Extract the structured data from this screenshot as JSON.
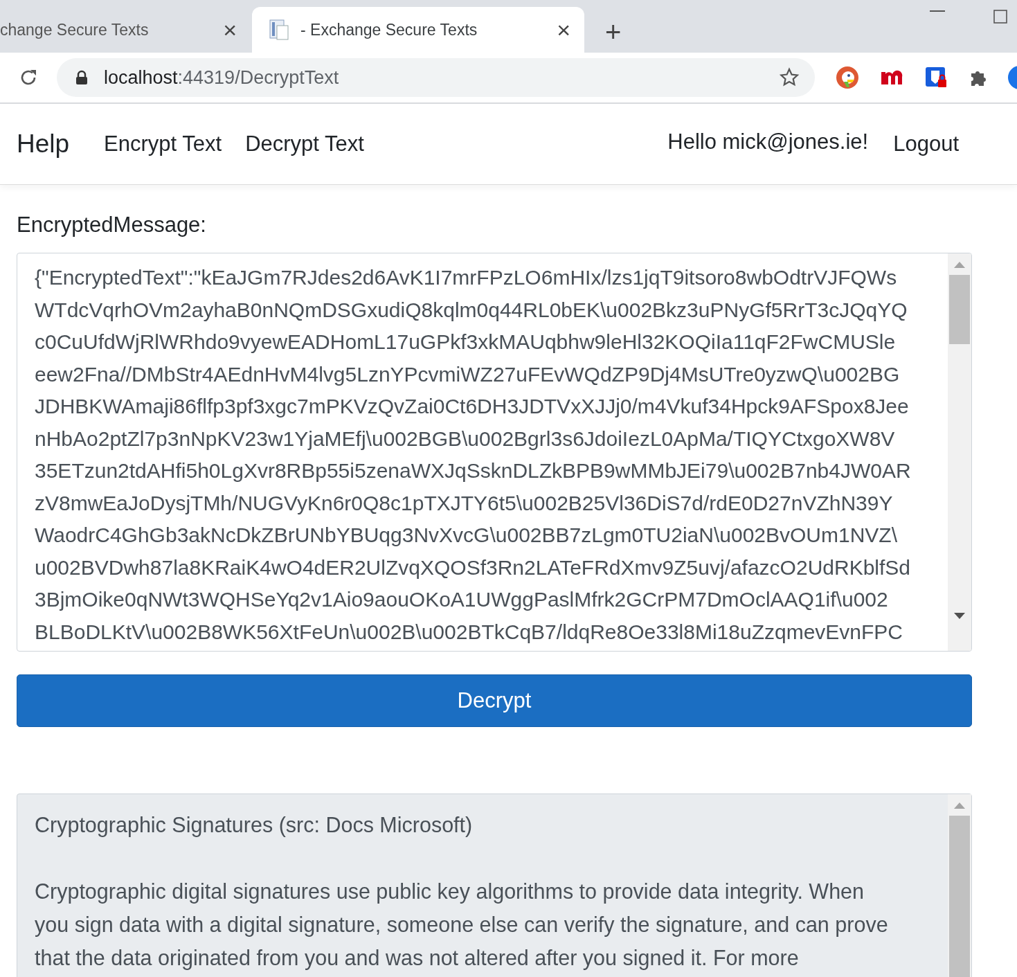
{
  "browser": {
    "tabs": [
      {
        "title": "change Secure Texts",
        "selected": false,
        "close": "×"
      },
      {
        "title": "- Exchange Secure Texts",
        "selected": true,
        "close": "×"
      }
    ],
    "new_tab": "+",
    "url_host": "localhost",
    "url_rest": ":44319/DecryptText"
  },
  "navbar": {
    "brand": "Help",
    "links": [
      "Encrypt Text",
      "Decrypt Text"
    ],
    "greeting": "Hello mick@jones.ie!",
    "logout": "Logout"
  },
  "form": {
    "label": "EncryptedMessage:",
    "value_lines": [
      "{\"EncryptedText\":\"kEaJGm7RJdes2d6AvK1I7mrFPzLO6mHIx/lzs1jqT9itsoro8wbOdtrVJFQWs",
      "WTdcVqrhOVm2ayhaB0nNQmDSGxudiQ8kqlm0q44RL0bEK\\u002Bkz3uPNyGf5RrT3cJQqYQ",
      "c0CuUfdWjRlWRhdo9vyewEADHomL17uGPkf3xkMAUqbhw9leHl32KOQiIa11qF2FwCMUSle",
      "eew2Fna//DMbStr4AEdnHvM4lvg5LznYPcvmiWZ27uFEvWQdZP9Dj4MsUTre0yzwQ\\u002BG",
      "JDHBKWAmaji86flfp3pf3xgc7mPKVzQvZai0Ct6DH3JDTVxXJJj0/m4Vkuf34Hpck9AFSpox8Jee",
      "nHbAo2ptZl7p3nNpKV23w1YjaMEfj\\u002BGB\\u002Bgrl3s6JdoiIezL0ApMa/TIQYCtxgoXW8V",
      "35ETzun2tdAHfi5h0LgXvr8RBp55i5zenaWXJqSsknDLZkBPB9wMMbJEi79\\u002B7nb4JW0AR",
      "zV8mwEaJoDysjTMh/NUGVyKn6r0Q8c1pTXJTY6t5\\u002B25Vl36DiS7d/rdE0D27nVZhN39Y",
      "WaodrC4GhGb3akNcDkZBrUNbYBUqg3NvXvcG\\u002BB7zLgm0TU2iaN\\u002BvOUm1NVZ\\",
      "u002BVDwh87la8KRaiK4wO4dER2UlZvqXQOSf3Rn2LATeFRdXmv9Z5uvj/afazcO2UdRKblfSd",
      "3BjmOike0qNWt3WQHSeYq2v1Aio9aouOKoA1UWggPaslMfrk2GCrPM7DmOclAAQ1if\\u002",
      "BLBoDLKtV\\u002B8WK56XtFeUn\\u002B\\u002BTkCqB7/ldqRe8Oe33l8Mi18uZzqmevEvnFPC"
    ],
    "button": "Decrypt"
  },
  "info": {
    "title": "Cryptographic Signatures (src: Docs Microsoft)",
    "paragraph_lines": [
      "Cryptographic digital signatures use public key algorithms to provide data integrity. When",
      "you sign data with a digital signature, someone else can verify the signature, and can prove",
      "that the data originated from you and was not altered after you signed it. For more"
    ]
  }
}
